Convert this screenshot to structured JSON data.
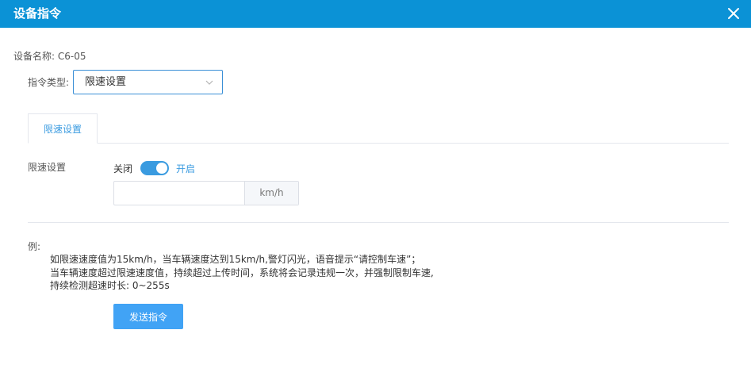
{
  "dialog": {
    "title": "设备指令"
  },
  "device": {
    "name_text": "设备名称: C6-05"
  },
  "command_type": {
    "label": "指令类型:",
    "selected": "限速设置"
  },
  "tabs": [
    {
      "label": "限速设置",
      "active": true
    }
  ],
  "speed_setting": {
    "label": "限速设置",
    "switch_off_label": "关闭",
    "switch_on_label": "开启",
    "switch_on": true,
    "input_value": "",
    "input_placeholder": "",
    "unit": "km/h"
  },
  "example": {
    "label": "例:",
    "lines": [
      "如限速速度值为15km/h，当车辆速度达到15km/h,警灯闪光，语音提示“请控制车速”；",
      "当车辆速度超过限速速度值，持续超过上传时间，系统将会记录违规一次，并强制限制车速,",
      "持续检测超速时长: 0~255s"
    ]
  },
  "actions": {
    "send_label": "发送指令"
  },
  "colors": {
    "titlebar": "#0b92d6",
    "accent": "#3a9be0",
    "button": "#41a3f5",
    "select_border": "#3a8fd6"
  },
  "icons": {
    "close": "close-icon",
    "dropdown": "chevron-down-icon"
  }
}
